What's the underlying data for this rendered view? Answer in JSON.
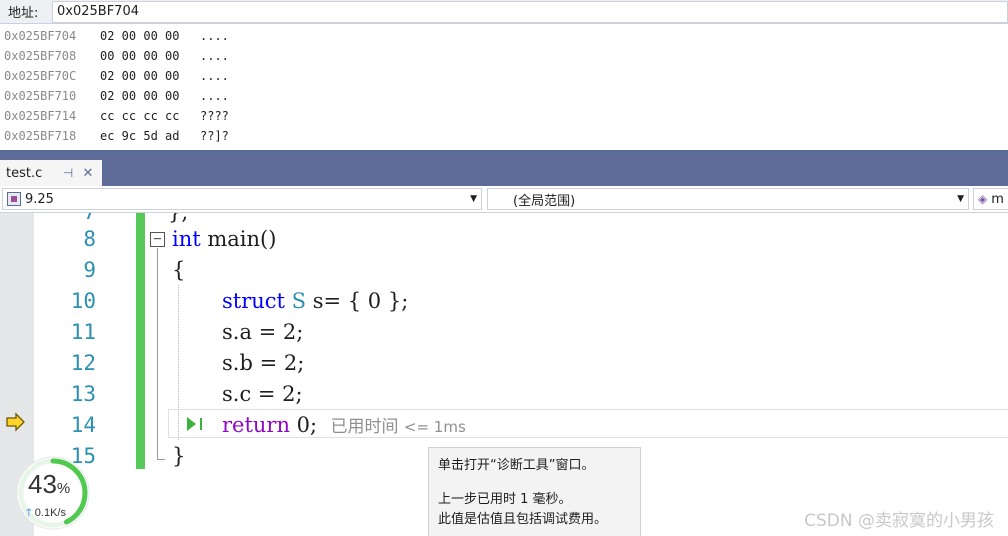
{
  "address_bar": {
    "label": "地址:",
    "value": "0x025BF704"
  },
  "memory": {
    "rows": [
      {
        "addr": "0x025BF704",
        "bytes": "02 00 00 00",
        "ascii": "...."
      },
      {
        "addr": "0x025BF708",
        "bytes": "00 00 00 00",
        "ascii": "...."
      },
      {
        "addr": "0x025BF70C",
        "bytes": "02 00 00 00",
        "ascii": "...."
      },
      {
        "addr": "0x025BF710",
        "bytes": "02 00 00 00",
        "ascii": "...."
      },
      {
        "addr": "0x025BF714",
        "bytes": "cc cc cc cc",
        "ascii": "????"
      },
      {
        "addr": "0x025BF718",
        "bytes": "ec 9c 5d ad",
        "ascii": "??]?"
      }
    ]
  },
  "tab": {
    "label": "test.c",
    "pin": "⊣",
    "close": "✕"
  },
  "nav": {
    "project": "9.25",
    "scope": "(全局范围)",
    "member": "m"
  },
  "editor": {
    "lines": [
      {
        "num": "8",
        "text_kw": "int",
        "text_rest": " main()"
      },
      {
        "num": "9",
        "text": "{"
      },
      {
        "num": "10",
        "text_kw": "struct",
        "text_type": " S",
        "text_rest": " s= { 0 };"
      },
      {
        "num": "11",
        "text": "s.a = 2;"
      },
      {
        "num": "12",
        "text": "s.b = 2;"
      },
      {
        "num": "13",
        "text": "s.c = 2;"
      },
      {
        "num": "14",
        "text_kw": "return",
        "text_rest": " 0;"
      },
      {
        "num": "15",
        "text": "}"
      }
    ],
    "top_partial": "};",
    "elapsed_label": "已用时间",
    "elapsed_value": "<= 1ms"
  },
  "tooltip": {
    "line1": "单击打开“诊断工具”窗口。",
    "line2": "上一步已用时 1 毫秒。",
    "line3": "此值是估值且包括调试费用。"
  },
  "perf": {
    "percent": "43",
    "percent_sign": "%",
    "speed": "0.1K/s",
    "ring_fraction": 0.43
  },
  "watermark": "CSDN @卖寂寞的小男孩",
  "colors": {
    "tab_strip": "#5d6b99",
    "change_bar": "#57c959",
    "keyword": "#0000ff",
    "return_kw": "#8f08c4",
    "line_num": "#2b91af"
  }
}
